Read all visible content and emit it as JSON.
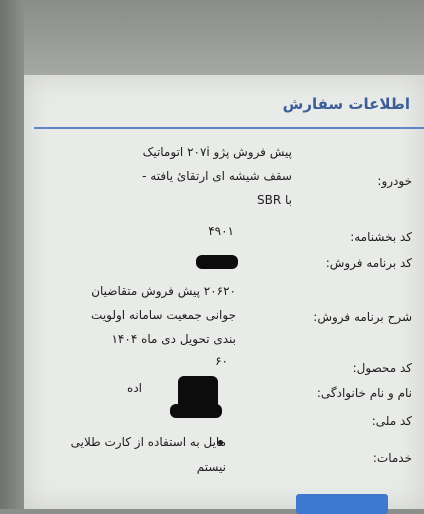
{
  "panel": {
    "title": "اطلاعات سفارش"
  },
  "fields": {
    "car_label": "خودرو:",
    "car_line1": "پیش فروش پژو ۲۰۷i اتوماتیک",
    "car_line2": "سقف شیشه ای ارتقائ یافته -",
    "car_line3": "با SBR",
    "confirmation_label": "کد بخشنامه:",
    "confirmation_value": "۴۹۰۱",
    "program_code_label": "کد برنامه فروش:",
    "program_desc_label": "شرح برنامه فروش:",
    "program_desc_line1": "۲۰۶۲۰ پیش فروش متقاضیان",
    "program_desc_line2": "جوانی جمعیت سامانه اولویت",
    "program_desc_line3": "بندی تحویل دی ماه ۱۴۰۴",
    "product_code_label": "کد محصول:",
    "product_code_value": "۶۰",
    "name_label": "نام و نام خانوادگی:",
    "name_partial": "اده",
    "national_code_label": "کد ملی:",
    "services_label": "خدمات:",
    "service_item": "مایل به استفاده از کارت طلایی",
    "service_item2": "نیستم"
  }
}
